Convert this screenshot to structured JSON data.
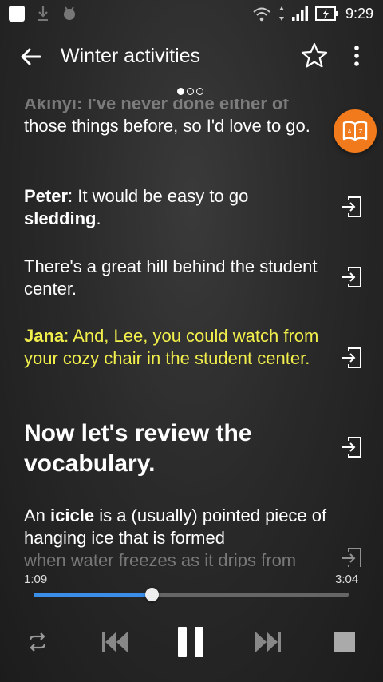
{
  "status_bar": {
    "time": "9:29"
  },
  "app_bar": {
    "title": "Winter activities"
  },
  "pager": {
    "count": 3,
    "active": 0
  },
  "transcript": {
    "cut_top": "Akinyi: I've never done either of",
    "p1": "those things before, so I'd love to go.",
    "p2": {
      "speaker": "Peter",
      "a": ": It would be easy to go ",
      "bold": "sledding",
      "b": "."
    },
    "p3": "There's a great hill behind the student center.",
    "p4": {
      "speaker": "Jana",
      "text": ": And, Lee, you could watch from your cozy chair in the student center."
    },
    "p5": "Now let's review the vocabulary.",
    "p6": {
      "a": "An ",
      "bold": "icicle",
      "b": " is a (usually) pointed piece of hanging ice that is formed",
      "cut": "when water freezes as it drips from"
    }
  },
  "player": {
    "elapsed": "1:09",
    "total": "3:04",
    "progress": 0.375
  },
  "colors": {
    "accent": "#3a8ee8",
    "highlight": "#f2ef4c",
    "dict_button": "#f07a1c"
  },
  "icons": [
    "back-arrow-icon",
    "star-icon",
    "more-vert-icon",
    "dictionary-icon",
    "goto-icon",
    "repeat-icon",
    "skip-previous-icon",
    "pause-icon",
    "skip-next-icon",
    "stop-icon"
  ]
}
